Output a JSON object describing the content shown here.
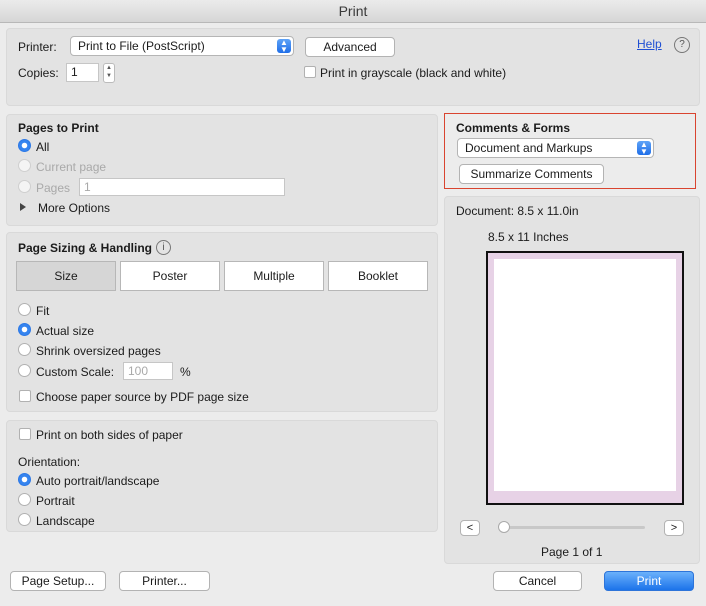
{
  "window": {
    "title": "Print"
  },
  "printer": {
    "label": "Printer:",
    "value": "Print to File (PostScript)",
    "advanced": "Advanced"
  },
  "copies": {
    "label": "Copies:",
    "value": "1"
  },
  "grayscale": {
    "label": "Print in grayscale (black and white)"
  },
  "help": {
    "label": "Help",
    "icon": "?"
  },
  "pages": {
    "title": "Pages to Print",
    "all": "All",
    "current": "Current page",
    "pages": "Pages",
    "pages_value": "1",
    "more": "More Options"
  },
  "comments": {
    "title": "Comments & Forms",
    "value": "Document and Markups",
    "summarize": "Summarize Comments"
  },
  "sizing": {
    "title": "Page Sizing & Handling",
    "info_icon": "i",
    "tabs": [
      "Size",
      "Poster",
      "Multiple",
      "Booklet"
    ],
    "fit": "Fit",
    "actual": "Actual size",
    "shrink": "Shrink oversized pages",
    "custom": "Custom Scale:",
    "custom_value": "100",
    "percent": "%",
    "paper_source": "Choose paper source by PDF page size"
  },
  "duplex": {
    "label": "Print on both sides of paper"
  },
  "orientation": {
    "title": "Orientation:",
    "auto": "Auto portrait/landscape",
    "portrait": "Portrait",
    "landscape": "Landscape"
  },
  "preview": {
    "document": "Document: 8.5 x 11.0in",
    "paper": "8.5 x 11 Inches",
    "prev": "<",
    "next": ">",
    "page_info": "Page 1 of 1",
    "slider_position": 0
  },
  "footer": {
    "page_setup": "Page Setup...",
    "printer": "Printer...",
    "cancel": "Cancel",
    "print": "Print"
  },
  "colors": {
    "accent": "#1c73ea",
    "highlight_border": "#d9442f",
    "page_border": "#111111",
    "margin_tint": "#e7d2e6"
  }
}
